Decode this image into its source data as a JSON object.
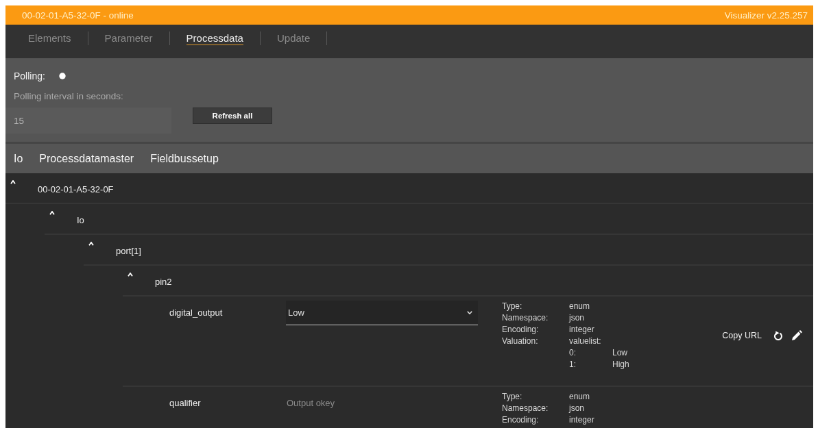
{
  "title_bar": {
    "device": "00-02-01-A5-32-0F - online",
    "version": "Visualizer v2.25.257"
  },
  "tabs": [
    {
      "label": "Elements",
      "selected": false
    },
    {
      "label": "Parameter",
      "selected": false
    },
    {
      "label": "Processdata",
      "selected": true
    },
    {
      "label": "Update",
      "selected": false
    }
  ],
  "polling": {
    "label": "Polling:",
    "on": true,
    "interval_label": "Polling interval in seconds:",
    "interval_value": "15",
    "refresh_button": "Refresh all"
  },
  "sections": [
    "Io",
    "Processdatamaster",
    "Fieldbussetup"
  ],
  "tree": [
    {
      "kind": "node",
      "label": "00-02-01-A5-32-0F",
      "expanded": true,
      "children": [
        {
          "kind": "node",
          "label": "Io",
          "expanded": true,
          "children": [
            {
              "kind": "node",
              "label": "port[1]",
              "expanded": true,
              "children": [
                {
                  "kind": "node",
                  "label": "pin2",
                  "expanded": true,
                  "children": [
                    {
                      "kind": "select",
                      "name": "digital_output",
                      "value": "Low",
                      "info": [
                        {
                          "label": "Type:",
                          "value": "enum"
                        },
                        {
                          "label": "Namespace:",
                          "value": "json"
                        },
                        {
                          "label": "Encoding:",
                          "value": "integer"
                        },
                        {
                          "label": "Valuation:",
                          "value": "valuelist:"
                        }
                      ],
                      "valuelist": [
                        {
                          "key": "0:",
                          "label": "Low"
                        },
                        {
                          "key": "1:",
                          "label": "High"
                        }
                      ],
                      "copy_url": "Copy URL"
                    },
                    {
                      "kind": "text",
                      "name": "qualifier",
                      "value": "Output okey",
                      "info": [
                        {
                          "label": "Type:",
                          "value": "enum"
                        },
                        {
                          "label": "Namespace:",
                          "value": "json"
                        },
                        {
                          "label": "Encoding:",
                          "value": "integer"
                        }
                      ]
                    }
                  ]
                }
              ]
            }
          ]
        }
      ]
    }
  ]
}
